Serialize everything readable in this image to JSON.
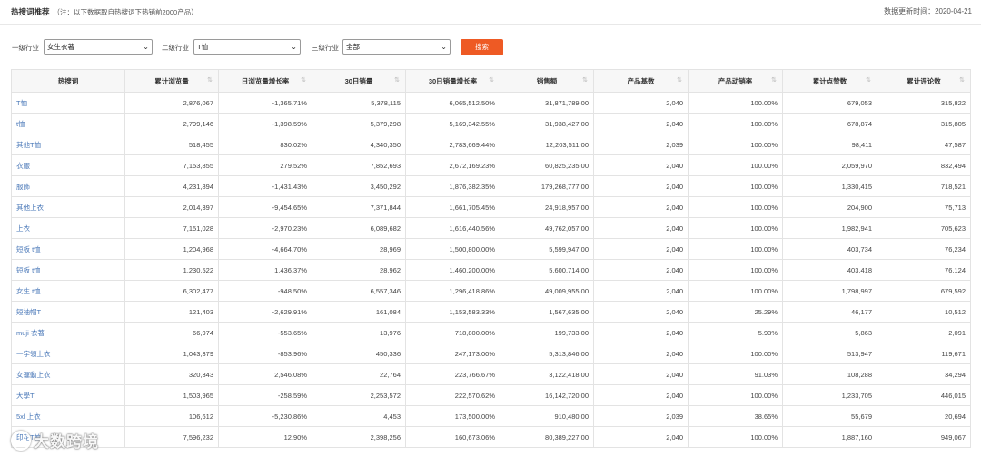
{
  "header": {
    "title": "热搜词推荐",
    "note": "（注：以下数据取自热搜词下热销前2000产品）",
    "update_label": "数据更新时间：",
    "update_date": "2020-04-21"
  },
  "filters": {
    "level1_label": "一级行业",
    "level1_value": "女生衣著",
    "level2_label": "二级行业",
    "level2_value": "T恤",
    "level3_label": "三级行业",
    "level3_value": "全部",
    "search_button": "搜索"
  },
  "table": {
    "columns": [
      "热搜词",
      "累计浏览量",
      "日浏览量增长率",
      "30日销量",
      "30日销量增长率",
      "销售额",
      "产品基数",
      "产品动销率",
      "累计点赞数",
      "累计评论数"
    ],
    "rows": [
      [
        "T恤",
        "2,876,067",
        "-1,365.71%",
        "5,378,115",
        "6,065,512.50%",
        "31,871,789.00",
        "2,040",
        "100.00%",
        "679,053",
        "315,822"
      ],
      [
        "t恤",
        "2,799,146",
        "-1,398.59%",
        "5,379,298",
        "5,169,342.55%",
        "31,938,427.00",
        "2,040",
        "100.00%",
        "678,874",
        "315,805"
      ],
      [
        "其他T恤",
        "518,455",
        "830.02%",
        "4,340,350",
        "2,783,669.44%",
        "12,203,511.00",
        "2,039",
        "100.00%",
        "98,411",
        "47,587"
      ],
      [
        "衣服",
        "7,153,855",
        "279.52%",
        "7,852,693",
        "2,672,169.23%",
        "60,825,235.00",
        "2,040",
        "100.00%",
        "2,059,970",
        "832,494"
      ],
      [
        "服飾",
        "4,231,894",
        "-1,431.43%",
        "3,450,292",
        "1,876,382.35%",
        "179,268,777.00",
        "2,040",
        "100.00%",
        "1,330,415",
        "718,521"
      ],
      [
        "其他上衣",
        "2,014,397",
        "-9,454.65%",
        "7,371,844",
        "1,661,705.45%",
        "24,918,957.00",
        "2,040",
        "100.00%",
        "204,900",
        "75,713"
      ],
      [
        "上衣",
        "7,151,028",
        "-2,970.23%",
        "6,089,682",
        "1,616,440.56%",
        "49,762,057.00",
        "2,040",
        "100.00%",
        "1,982,941",
        "705,623"
      ],
      [
        "短板 t恤",
        "1,204,968",
        "-4,664.70%",
        "28,969",
        "1,500,800.00%",
        "5,599,947.00",
        "2,040",
        "100.00%",
        "403,734",
        "76,234"
      ],
      [
        "短板 t恤",
        "1,230,522",
        "1,436.37%",
        "28,962",
        "1,460,200.00%",
        "5,600,714.00",
        "2,040",
        "100.00%",
        "403,418",
        "76,124"
      ],
      [
        "女生 t恤",
        "6,302,477",
        "-948.50%",
        "6,557,346",
        "1,296,418.86%",
        "49,009,955.00",
        "2,040",
        "100.00%",
        "1,798,997",
        "679,592"
      ],
      [
        "短袖帽T",
        "121,403",
        "-2,629.91%",
        "161,084",
        "1,153,583.33%",
        "1,567,635.00",
        "2,040",
        "25.29%",
        "46,177",
        "10,512"
      ],
      [
        "muji 衣著",
        "66,974",
        "-553.65%",
        "13,976",
        "718,800.00%",
        "199,733.00",
        "2,040",
        "5.93%",
        "5,863",
        "2,091"
      ],
      [
        "一字領上衣",
        "1,043,379",
        "-853.96%",
        "450,336",
        "247,173.00%",
        "5,313,846.00",
        "2,040",
        "100.00%",
        "513,947",
        "119,671"
      ],
      [
        "女運動上衣",
        "320,343",
        "2,546.08%",
        "22,764",
        "223,766.67%",
        "3,122,418.00",
        "2,040",
        "91.03%",
        "108,288",
        "34,294"
      ],
      [
        "大學T",
        "1,503,965",
        "-258.59%",
        "2,253,572",
        "222,570.62%",
        "16,142,720.00",
        "2,040",
        "100.00%",
        "1,233,705",
        "446,015"
      ],
      [
        "5xl 上衣",
        "106,612",
        "-5,230.86%",
        "4,453",
        "173,500.00%",
        "910,480.00",
        "2,039",
        "38.65%",
        "55,679",
        "20,694"
      ],
      [
        "印花T恤",
        "7,596,232",
        "12.90%",
        "2,398,256",
        "160,673.06%",
        "80,389,227.00",
        "2,040",
        "100.00%",
        "1,887,160",
        "949,067"
      ]
    ]
  },
  "watermark": {
    "text": "大数跨境"
  }
}
